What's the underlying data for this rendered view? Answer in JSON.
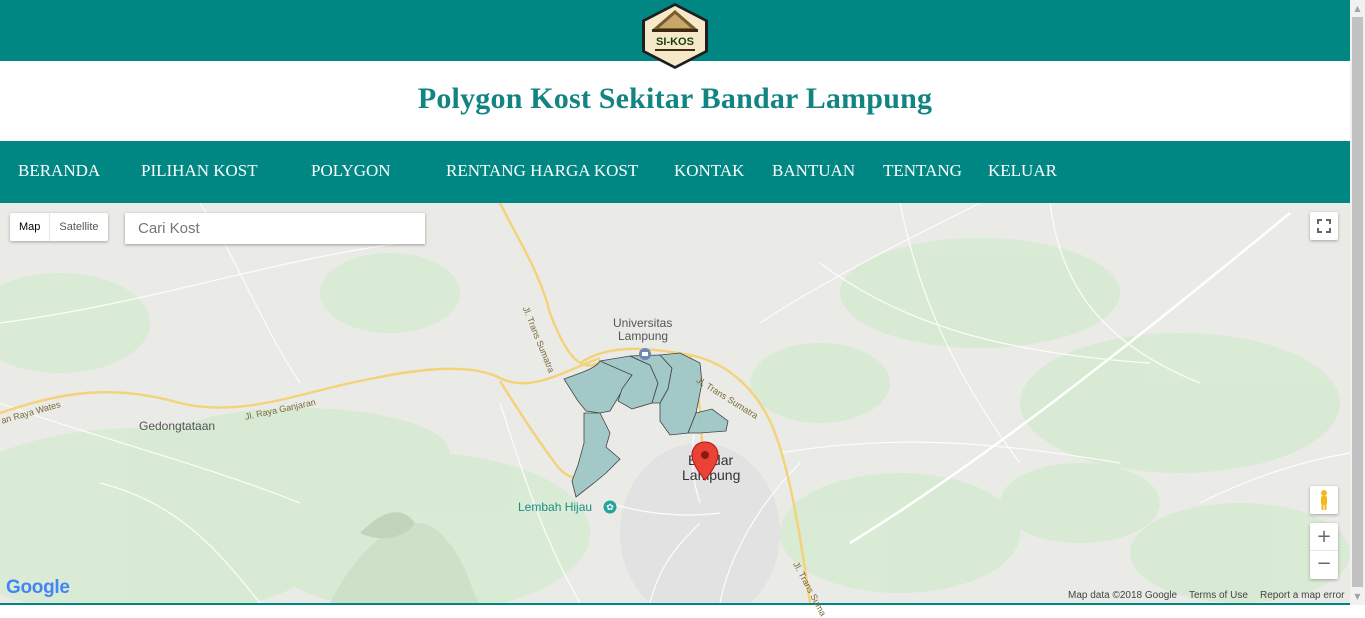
{
  "header": {
    "logo_text": "SI-KOS",
    "title": "Polygon Kost Sekitar Bandar Lampung"
  },
  "nav": {
    "items": [
      "BERANDA",
      "PILIHAN KOST",
      "POLYGON",
      "RENTANG HARGA KOST",
      "KONTAK",
      "BANTUAN",
      "TENTANG",
      "KELUAR"
    ]
  },
  "map": {
    "type_map": "Map",
    "type_satellite": "Satellite",
    "search_placeholder": "Cari Kost",
    "labels": {
      "universitas": "Universitas",
      "lampung": "Lampung",
      "gedongtataan": "Gedongtataan",
      "lembah_hijau": "Lembah Hijau",
      "bandar": "Bandar",
      "lampung_city": "Lampung",
      "road_trans1": "Jl. Trans Sumatra",
      "road_trans2": "Jl. Trans Sumatra",
      "road_trans3": "Jl. Trans Suma",
      "road_ganjaran": "Jl. Raya Ganjaran",
      "road_wates": "an Raya Wates"
    },
    "google_logo": "Google",
    "map_data": "Map data ©2018 Google",
    "terms": "Terms of Use",
    "report": "Report a map error",
    "zoom_in": "+",
    "zoom_out": "−"
  },
  "colors": {
    "brand": "#008784",
    "title": "#128582",
    "polygon_fill": "#9fc8c6",
    "marker": "#ea4335"
  }
}
